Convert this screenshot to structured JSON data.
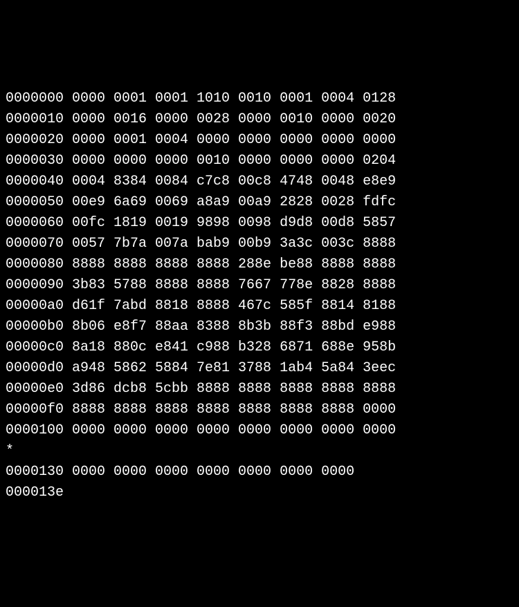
{
  "hexdump": {
    "lines": [
      {
        "offset": "0000000",
        "values": [
          "0000",
          "0001",
          "0001",
          "1010",
          "0010",
          "0001",
          "0004",
          "0128"
        ]
      },
      {
        "offset": "0000010",
        "values": [
          "0000",
          "0016",
          "0000",
          "0028",
          "0000",
          "0010",
          "0000",
          "0020"
        ]
      },
      {
        "offset": "0000020",
        "values": [
          "0000",
          "0001",
          "0004",
          "0000",
          "0000",
          "0000",
          "0000",
          "0000"
        ]
      },
      {
        "offset": "0000030",
        "values": [
          "0000",
          "0000",
          "0000",
          "0010",
          "0000",
          "0000",
          "0000",
          "0204"
        ]
      },
      {
        "offset": "0000040",
        "values": [
          "0004",
          "8384",
          "0084",
          "c7c8",
          "00c8",
          "4748",
          "0048",
          "e8e9"
        ]
      },
      {
        "offset": "0000050",
        "values": [
          "00e9",
          "6a69",
          "0069",
          "a8a9",
          "00a9",
          "2828",
          "0028",
          "fdfc"
        ]
      },
      {
        "offset": "0000060",
        "values": [
          "00fc",
          "1819",
          "0019",
          "9898",
          "0098",
          "d9d8",
          "00d8",
          "5857"
        ]
      },
      {
        "offset": "0000070",
        "values": [
          "0057",
          "7b7a",
          "007a",
          "bab9",
          "00b9",
          "3a3c",
          "003c",
          "8888"
        ]
      },
      {
        "offset": "0000080",
        "values": [
          "8888",
          "8888",
          "8888",
          "8888",
          "288e",
          "be88",
          "8888",
          "8888"
        ]
      },
      {
        "offset": "0000090",
        "values": [
          "3b83",
          "5788",
          "8888",
          "8888",
          "7667",
          "778e",
          "8828",
          "8888"
        ]
      },
      {
        "offset": "00000a0",
        "values": [
          "d61f",
          "7abd",
          "8818",
          "8888",
          "467c",
          "585f",
          "8814",
          "8188"
        ]
      },
      {
        "offset": "00000b0",
        "values": [
          "8b06",
          "e8f7",
          "88aa",
          "8388",
          "8b3b",
          "88f3",
          "88bd",
          "e988"
        ]
      },
      {
        "offset": "00000c0",
        "values": [
          "8a18",
          "880c",
          "e841",
          "c988",
          "b328",
          "6871",
          "688e",
          "958b"
        ]
      },
      {
        "offset": "00000d0",
        "values": [
          "a948",
          "5862",
          "5884",
          "7e81",
          "3788",
          "1ab4",
          "5a84",
          "3eec"
        ]
      },
      {
        "offset": "00000e0",
        "values": [
          "3d86",
          "dcb8",
          "5cbb",
          "8888",
          "8888",
          "8888",
          "8888",
          "8888"
        ]
      },
      {
        "offset": "00000f0",
        "values": [
          "8888",
          "8888",
          "8888",
          "8888",
          "8888",
          "8888",
          "8888",
          "0000"
        ]
      },
      {
        "offset": "0000100",
        "values": [
          "0000",
          "0000",
          "0000",
          "0000",
          "0000",
          "0000",
          "0000",
          "0000"
        ]
      },
      {
        "offset": "*",
        "values": []
      },
      {
        "offset": "0000130",
        "values": [
          "0000",
          "0000",
          "0000",
          "0000",
          "0000",
          "0000",
          "0000"
        ]
      },
      {
        "offset": "000013e",
        "values": []
      }
    ]
  }
}
